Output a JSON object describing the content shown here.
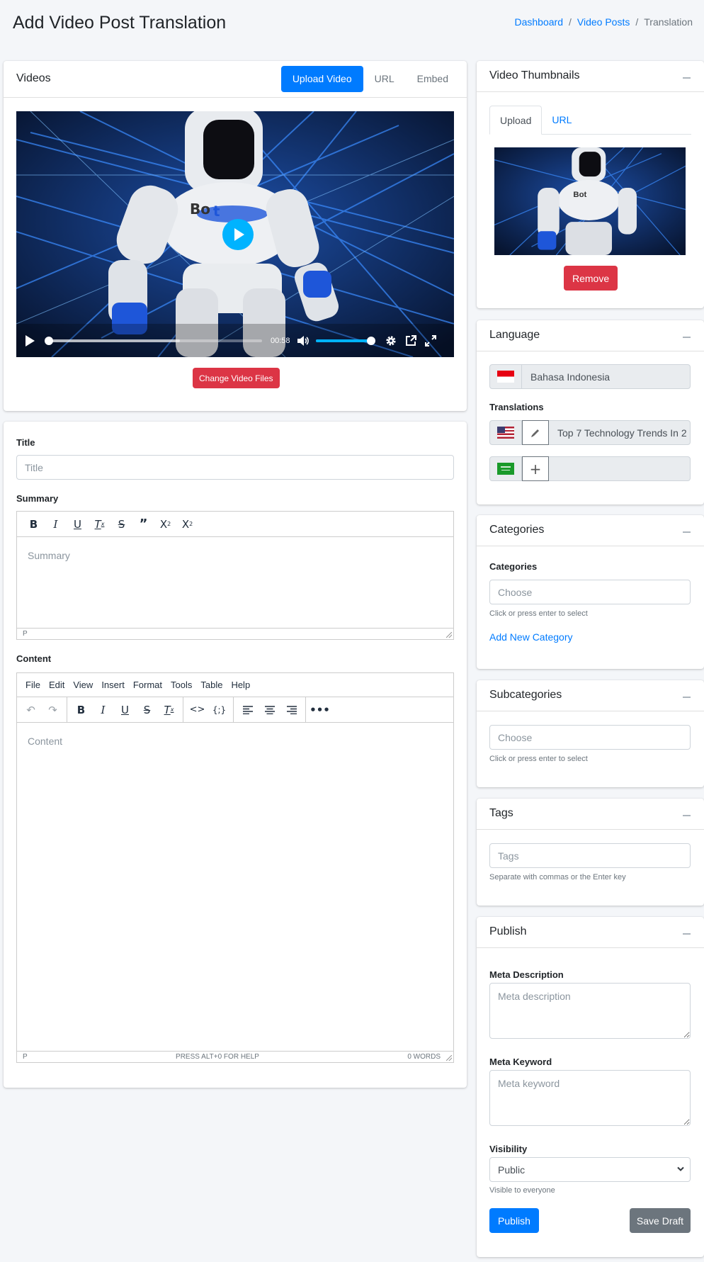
{
  "header": {
    "title": "Add Video Post Translation",
    "breadcrumb": [
      {
        "label": "Dashboard"
      },
      {
        "label": "Video Posts"
      },
      {
        "label": "Translation"
      }
    ],
    "separator": "/"
  },
  "videos": {
    "title": "Videos",
    "tabs": [
      {
        "label": "Upload Video",
        "active": true
      },
      {
        "label": "URL",
        "active": false
      },
      {
        "label": "Embed",
        "active": false
      }
    ],
    "player": {
      "time": "00:58",
      "progress": 0.0,
      "buffered": 0.62,
      "volume": 1.0,
      "icons": [
        "play-icon",
        "volume-icon",
        "settings-icon",
        "pip-icon",
        "fullscreen-icon"
      ]
    },
    "change_button": "Change Video Files"
  },
  "form": {
    "title_label": "Title",
    "title_placeholder": "Title",
    "summary_label": "Summary",
    "summary_placeholder": "Summary",
    "summary_toolbar": [
      "bold",
      "italic",
      "underline",
      "clear-format",
      "strikethrough",
      "blockquote",
      "superscript",
      "subscript"
    ],
    "summary_status": "P",
    "content_label": "Content",
    "content_placeholder": "Content",
    "content_menu": [
      "File",
      "Edit",
      "View",
      "Insert",
      "Format",
      "Tools",
      "Table",
      "Help"
    ],
    "content_status_path": "P",
    "content_status_help": "PRESS ALT+0 FOR HELP",
    "content_status_words": "0 WORDS"
  },
  "thumbnails": {
    "title": "Video Thumbnails",
    "tabs": [
      {
        "label": "Upload",
        "active": true
      },
      {
        "label": "URL",
        "active": false
      }
    ],
    "remove_button": "Remove"
  },
  "language": {
    "title": "Language",
    "current": "Bahasa Indonesia",
    "translations_label": "Translations",
    "translations": [
      {
        "flag": "us-flag",
        "action": "edit",
        "value": "Top 7 Technology Trends In 2"
      },
      {
        "flag": "sa-flag",
        "action": "add",
        "value": ""
      }
    ]
  },
  "categories": {
    "title": "Categories",
    "label": "Categories",
    "placeholder": "Choose",
    "help": "Click or press enter to select",
    "add_link": "Add New Category"
  },
  "subcategories": {
    "title": "Subcategories",
    "placeholder": "Choose",
    "help": "Click or press enter to select"
  },
  "tags": {
    "title": "Tags",
    "placeholder": "Tags",
    "help": "Separate with commas or the Enter key"
  },
  "publish": {
    "title": "Publish",
    "meta_description_label": "Meta Description",
    "meta_description_placeholder": "Meta description",
    "meta_keyword_label": "Meta Keyword",
    "meta_keyword_placeholder": "Meta keyword",
    "visibility_label": "Visibility",
    "visibility_value": "Public",
    "visibility_help": "Visible to everyone",
    "publish_button": "Publish",
    "draft_button": "Save Draft"
  },
  "colors": {
    "primary": "#007bff",
    "danger": "#dc3545",
    "secondary": "#6c757d",
    "player_accent": "#00b3ff"
  }
}
